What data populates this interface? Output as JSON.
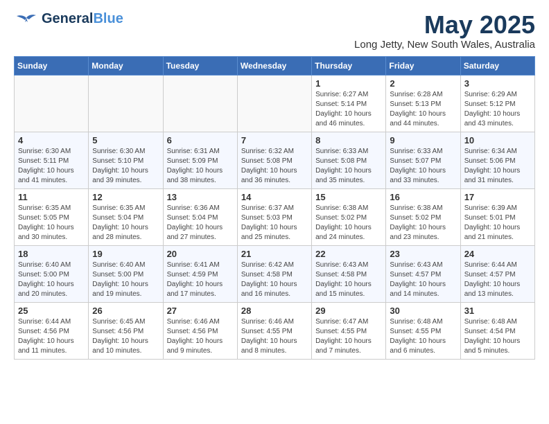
{
  "header": {
    "logo_general": "General",
    "logo_blue": "Blue",
    "month_title": "May 2025",
    "location": "Long Jetty, New South Wales, Australia"
  },
  "days_of_week": [
    "Sunday",
    "Monday",
    "Tuesday",
    "Wednesday",
    "Thursday",
    "Friday",
    "Saturday"
  ],
  "weeks": [
    [
      {
        "day": "",
        "info": ""
      },
      {
        "day": "",
        "info": ""
      },
      {
        "day": "",
        "info": ""
      },
      {
        "day": "",
        "info": ""
      },
      {
        "day": "1",
        "info": "Sunrise: 6:27 AM\nSunset: 5:14 PM\nDaylight: 10 hours and 46 minutes."
      },
      {
        "day": "2",
        "info": "Sunrise: 6:28 AM\nSunset: 5:13 PM\nDaylight: 10 hours and 44 minutes."
      },
      {
        "day": "3",
        "info": "Sunrise: 6:29 AM\nSunset: 5:12 PM\nDaylight: 10 hours and 43 minutes."
      }
    ],
    [
      {
        "day": "4",
        "info": "Sunrise: 6:30 AM\nSunset: 5:11 PM\nDaylight: 10 hours and 41 minutes."
      },
      {
        "day": "5",
        "info": "Sunrise: 6:30 AM\nSunset: 5:10 PM\nDaylight: 10 hours and 39 minutes."
      },
      {
        "day": "6",
        "info": "Sunrise: 6:31 AM\nSunset: 5:09 PM\nDaylight: 10 hours and 38 minutes."
      },
      {
        "day": "7",
        "info": "Sunrise: 6:32 AM\nSunset: 5:08 PM\nDaylight: 10 hours and 36 minutes."
      },
      {
        "day": "8",
        "info": "Sunrise: 6:33 AM\nSunset: 5:08 PM\nDaylight: 10 hours and 35 minutes."
      },
      {
        "day": "9",
        "info": "Sunrise: 6:33 AM\nSunset: 5:07 PM\nDaylight: 10 hours and 33 minutes."
      },
      {
        "day": "10",
        "info": "Sunrise: 6:34 AM\nSunset: 5:06 PM\nDaylight: 10 hours and 31 minutes."
      }
    ],
    [
      {
        "day": "11",
        "info": "Sunrise: 6:35 AM\nSunset: 5:05 PM\nDaylight: 10 hours and 30 minutes."
      },
      {
        "day": "12",
        "info": "Sunrise: 6:35 AM\nSunset: 5:04 PM\nDaylight: 10 hours and 28 minutes."
      },
      {
        "day": "13",
        "info": "Sunrise: 6:36 AM\nSunset: 5:04 PM\nDaylight: 10 hours and 27 minutes."
      },
      {
        "day": "14",
        "info": "Sunrise: 6:37 AM\nSunset: 5:03 PM\nDaylight: 10 hours and 25 minutes."
      },
      {
        "day": "15",
        "info": "Sunrise: 6:38 AM\nSunset: 5:02 PM\nDaylight: 10 hours and 24 minutes."
      },
      {
        "day": "16",
        "info": "Sunrise: 6:38 AM\nSunset: 5:02 PM\nDaylight: 10 hours and 23 minutes."
      },
      {
        "day": "17",
        "info": "Sunrise: 6:39 AM\nSunset: 5:01 PM\nDaylight: 10 hours and 21 minutes."
      }
    ],
    [
      {
        "day": "18",
        "info": "Sunrise: 6:40 AM\nSunset: 5:00 PM\nDaylight: 10 hours and 20 minutes."
      },
      {
        "day": "19",
        "info": "Sunrise: 6:40 AM\nSunset: 5:00 PM\nDaylight: 10 hours and 19 minutes."
      },
      {
        "day": "20",
        "info": "Sunrise: 6:41 AM\nSunset: 4:59 PM\nDaylight: 10 hours and 17 minutes."
      },
      {
        "day": "21",
        "info": "Sunrise: 6:42 AM\nSunset: 4:58 PM\nDaylight: 10 hours and 16 minutes."
      },
      {
        "day": "22",
        "info": "Sunrise: 6:43 AM\nSunset: 4:58 PM\nDaylight: 10 hours and 15 minutes."
      },
      {
        "day": "23",
        "info": "Sunrise: 6:43 AM\nSunset: 4:57 PM\nDaylight: 10 hours and 14 minutes."
      },
      {
        "day": "24",
        "info": "Sunrise: 6:44 AM\nSunset: 4:57 PM\nDaylight: 10 hours and 13 minutes."
      }
    ],
    [
      {
        "day": "25",
        "info": "Sunrise: 6:44 AM\nSunset: 4:56 PM\nDaylight: 10 hours and 11 minutes."
      },
      {
        "day": "26",
        "info": "Sunrise: 6:45 AM\nSunset: 4:56 PM\nDaylight: 10 hours and 10 minutes."
      },
      {
        "day": "27",
        "info": "Sunrise: 6:46 AM\nSunset: 4:56 PM\nDaylight: 10 hours and 9 minutes."
      },
      {
        "day": "28",
        "info": "Sunrise: 6:46 AM\nSunset: 4:55 PM\nDaylight: 10 hours and 8 minutes."
      },
      {
        "day": "29",
        "info": "Sunrise: 6:47 AM\nSunset: 4:55 PM\nDaylight: 10 hours and 7 minutes."
      },
      {
        "day": "30",
        "info": "Sunrise: 6:48 AM\nSunset: 4:55 PM\nDaylight: 10 hours and 6 minutes."
      },
      {
        "day": "31",
        "info": "Sunrise: 6:48 AM\nSunset: 4:54 PM\nDaylight: 10 hours and 5 minutes."
      }
    ]
  ]
}
